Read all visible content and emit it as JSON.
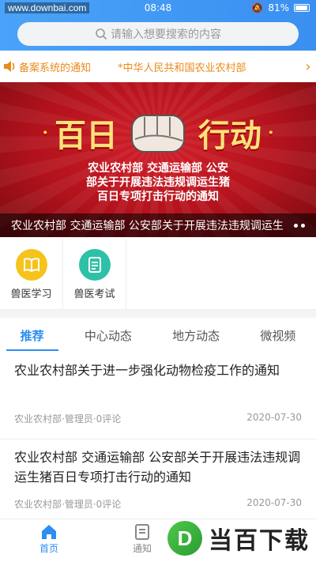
{
  "status_bar": {
    "watermark": "www.downbai.com",
    "time": "08:48",
    "battery": "81%"
  },
  "search": {
    "placeholder": "请输入想要搜索的内容"
  },
  "notice": {
    "items": [
      "备案系统的通知",
      "*中华人民共和国农业农村部"
    ]
  },
  "banner": {
    "title_left": "百日",
    "title_right": "行动",
    "subtitle_lines": [
      "农业农村部 交通运输部 公安",
      "部关于开展违法违规调运生猪",
      "百日专项打击行动的通知"
    ],
    "caption": "农业农村部 交通运输部 公安部关于开展违法违规调运生"
  },
  "quick_links": [
    {
      "label": "兽医学习",
      "icon": "book-icon"
    },
    {
      "label": "兽医考试",
      "icon": "exam-icon"
    }
  ],
  "tabs": [
    "推荐",
    "中心动态",
    "地方动态",
    "微视频"
  ],
  "active_tab": "推荐",
  "news": [
    {
      "title": "农业农村部关于进一步强化动物检疫工作的通知",
      "meta": "农业农村部·管理员·0评论",
      "date": "2020-07-30"
    },
    {
      "title": "农业农村部 交通运输部 公安部关于开展违法违规调运生猪百日专项打击行动的通知",
      "meta": "农业农村部·管理员·0评论",
      "date": "2020-07-30"
    }
  ],
  "bottom_nav": [
    {
      "label": "首页",
      "icon": "home-icon",
      "active": true
    },
    {
      "label": "通知",
      "icon": "notice-icon",
      "active": false
    }
  ],
  "watermark_logo": {
    "mark": "D",
    "text": "当百下载"
  },
  "colors": {
    "accent": "#2d8ef0",
    "notice": "#e98b1a",
    "banner_red": "#c21a24"
  }
}
